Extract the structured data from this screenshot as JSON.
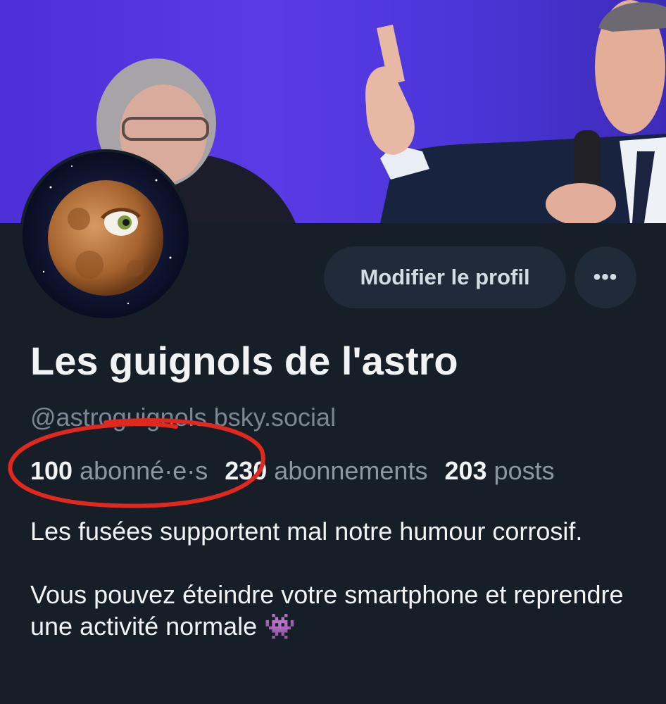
{
  "profile": {
    "display_name": "Les guignols de l'astro",
    "handle": "@astroguignols.bsky.social",
    "edit_button_label": "Modifier le profil",
    "more_button_label": "•••",
    "stats": {
      "followers_count": "100",
      "followers_label": "abonné·e·s",
      "following_count": "230",
      "following_label": "abonnements",
      "posts_count": "203",
      "posts_label": "posts"
    },
    "bio": {
      "line1": "Les fusées supportent mal notre humour corrosif.",
      "line2": "Vous pouvez éteindre votre smartphone et reprendre une activité normale 👾"
    }
  },
  "colors": {
    "background": "#161e27",
    "banner_purple": "#4c2fd6",
    "annotation_red": "#e0281f",
    "muted_text": "#8b97a3"
  }
}
